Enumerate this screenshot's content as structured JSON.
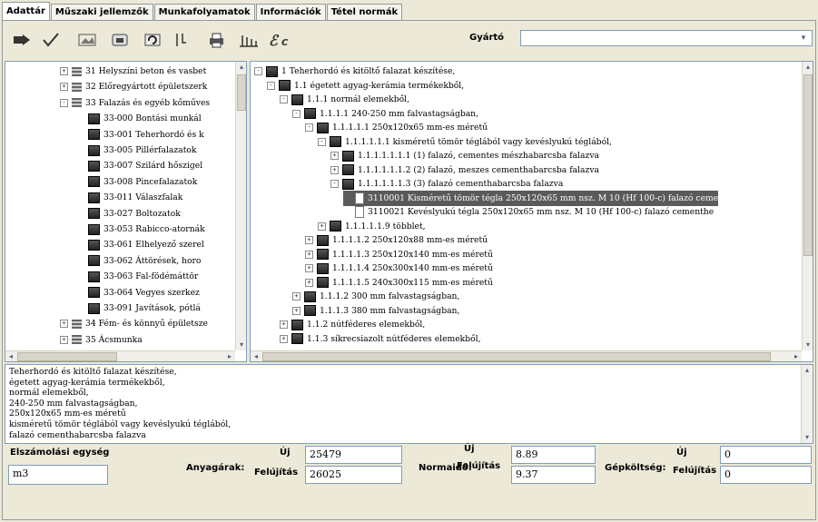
{
  "tabs": [
    "Adattár",
    "Műszaki jellemzők",
    "Munkafolyamatok",
    "Információk",
    "Tétel normák"
  ],
  "toolbar": {
    "gyarto_label": "Gyártó",
    "gyarto_value": "",
    "buttons": [
      "import-icon",
      "check-icon",
      "image-icon",
      "box-icon",
      "undo-icon",
      "filter-icon",
      "print-icon",
      "chart-icon",
      "ec-icon"
    ]
  },
  "left_tree": [
    {
      "t": "31 Helyszíni beton és vasbet",
      "lvl": 1,
      "pm": "+",
      "ic": "pile"
    },
    {
      "t": "32 Előregyártott épületszerk",
      "lvl": 1,
      "pm": "+",
      "ic": "pile"
    },
    {
      "t": "33 Falazás és egyéb kőműves",
      "lvl": 1,
      "pm": "−",
      "ic": "pile"
    },
    {
      "t": "33-000 Bontási munkál",
      "lvl": 2,
      "pm": "",
      "ic": "book"
    },
    {
      "t": "33-001 Teherhordó és k",
      "lvl": 2,
      "pm": "",
      "ic": "book"
    },
    {
      "t": "33-005 Pillérfalazatok",
      "lvl": 2,
      "pm": "",
      "ic": "book"
    },
    {
      "t": "33-007 Szilárd hőszigel",
      "lvl": 2,
      "pm": "",
      "ic": "book"
    },
    {
      "t": "33-008 Pincefalazatok",
      "lvl": 2,
      "pm": "",
      "ic": "book"
    },
    {
      "t": "33-011 Válaszfalak",
      "lvl": 2,
      "pm": "",
      "ic": "book"
    },
    {
      "t": "33-027 Boltozatok",
      "lvl": 2,
      "pm": "",
      "ic": "book"
    },
    {
      "t": "33-053 Rabicco-atornák",
      "lvl": 2,
      "pm": "",
      "ic": "book"
    },
    {
      "t": "33-061 Elhelyező szerel",
      "lvl": 2,
      "pm": "",
      "ic": "book"
    },
    {
      "t": "33-062 Áttörések, horo",
      "lvl": 2,
      "pm": "",
      "ic": "book"
    },
    {
      "t": "33-063 Fal-födémáttör",
      "lvl": 2,
      "pm": "",
      "ic": "book"
    },
    {
      "t": "33-064 Vegyes szerkez",
      "lvl": 2,
      "pm": "",
      "ic": "book"
    },
    {
      "t": "33-091 Javítások, pótlá",
      "lvl": 2,
      "pm": "",
      "ic": "book"
    },
    {
      "t": "34 Fém- és könnyű épületsze",
      "lvl": 1,
      "pm": "+",
      "ic": "pile"
    },
    {
      "t": "35 Ácsmunka",
      "lvl": 1,
      "pm": "+",
      "ic": "pile"
    }
  ],
  "right_tree": [
    {
      "t": "1 Teherhordó és kitöltő falazat készítése,",
      "lvl": 0,
      "pm": "−",
      "ic": "book"
    },
    {
      "t": "1.1 égetett agyag-kerámia termékekből,",
      "lvl": 1,
      "pm": "−",
      "ic": "book"
    },
    {
      "t": "1.1.1 normál elemekből,",
      "lvl": 2,
      "pm": "−",
      "ic": "book"
    },
    {
      "t": "1.1.1.1 240-250 mm falvastagságban,",
      "lvl": 3,
      "pm": "−",
      "ic": "book"
    },
    {
      "t": "1.1.1.1.1 250x120x65 mm-es méretű",
      "lvl": 4,
      "pm": "−",
      "ic": "book"
    },
    {
      "t": "1.1.1.1.1.1 kisméretű tömör téglából vagy kevéslyukú téglából,",
      "lvl": 5,
      "pm": "−",
      "ic": "book"
    },
    {
      "t": "1.1.1.1.1.1.1 (1) falazó, cementes mészhabarcsba falazva",
      "lvl": 6,
      "pm": "+",
      "ic": "book"
    },
    {
      "t": "1.1.1.1.1.1.2 (2) falazó, meszes cementhabarcsba falazva",
      "lvl": 6,
      "pm": "+",
      "ic": "book"
    },
    {
      "t": "1.1.1.1.1.1.3 (3) falazó cementhabarcsba falazva",
      "lvl": 6,
      "pm": "−",
      "ic": "book"
    },
    {
      "t": "3110001 Kisméretű tömör tégla 250x120x65 mm nsz. M 10 (Hf 100-c) falazó ceme",
      "lvl": 7,
      "pm": "",
      "ic": "doc",
      "sel": true
    },
    {
      "t": "3110021 Kevéslyukú tégla 250x120x65 mm nsz. M 10 (Hf 100-c) falazó cementhe",
      "lvl": 7,
      "pm": "",
      "ic": "doc"
    },
    {
      "t": "1.1.1.1.1.9 többlet,",
      "lvl": 5,
      "pm": "+",
      "ic": "book"
    },
    {
      "t": "1.1.1.1.2 250x120x88 mm-es méretű",
      "lvl": 4,
      "pm": "+",
      "ic": "book"
    },
    {
      "t": "1.1.1.1.3 250x120x140 mm-es méretű",
      "lvl": 4,
      "pm": "+",
      "ic": "book"
    },
    {
      "t": "1.1.1.1.4 250x300x140 mm-es méretű",
      "lvl": 4,
      "pm": "+",
      "ic": "book"
    },
    {
      "t": "1.1.1.1.5 240x300x115 mm-es méretű",
      "lvl": 4,
      "pm": "+",
      "ic": "book"
    },
    {
      "t": "1.1.1.2 300 mm falvastagságban,",
      "lvl": 3,
      "pm": "+",
      "ic": "book"
    },
    {
      "t": "1.1.1.3 380 mm falvastagságban,",
      "lvl": 3,
      "pm": "+",
      "ic": "book"
    },
    {
      "t": "1.1.2 nútféderes elemekből,",
      "lvl": 2,
      "pm": "+",
      "ic": "book"
    },
    {
      "t": "1.1.3 síkrecsiazolt nútféderes elemekből,",
      "lvl": 2,
      "pm": "+",
      "ic": "book"
    }
  ],
  "description": [
    "Teherhordó és kitöltő falazat készítése,",
    "égetett agyag-kerámia termékekből,",
    "normál elemekből,",
    "240-250 mm falvastagságban,",
    "250x120x65 mm-es méretű",
    "kisméretű tömör téglából vagy kevéslyukú téglából,",
    "falazó cementhabarcsba falazva"
  ],
  "bottom": {
    "elszamolasi_label": "Elszámolási egység",
    "elszamolasi_value": "m3",
    "anyagarak_label": "Anyagárak:",
    "normaido_label": "Normaidő:",
    "gepkoltseg_label": "Gépköltség:",
    "uj_label": "Új",
    "felujitas_label": "Felújítás",
    "anyag_uj": "25479",
    "anyag_felujitas": "26025",
    "norma_uj": "8.89",
    "norma_felujitas": "9.37",
    "gep_uj": "0",
    "gep_felujitas": "0"
  }
}
